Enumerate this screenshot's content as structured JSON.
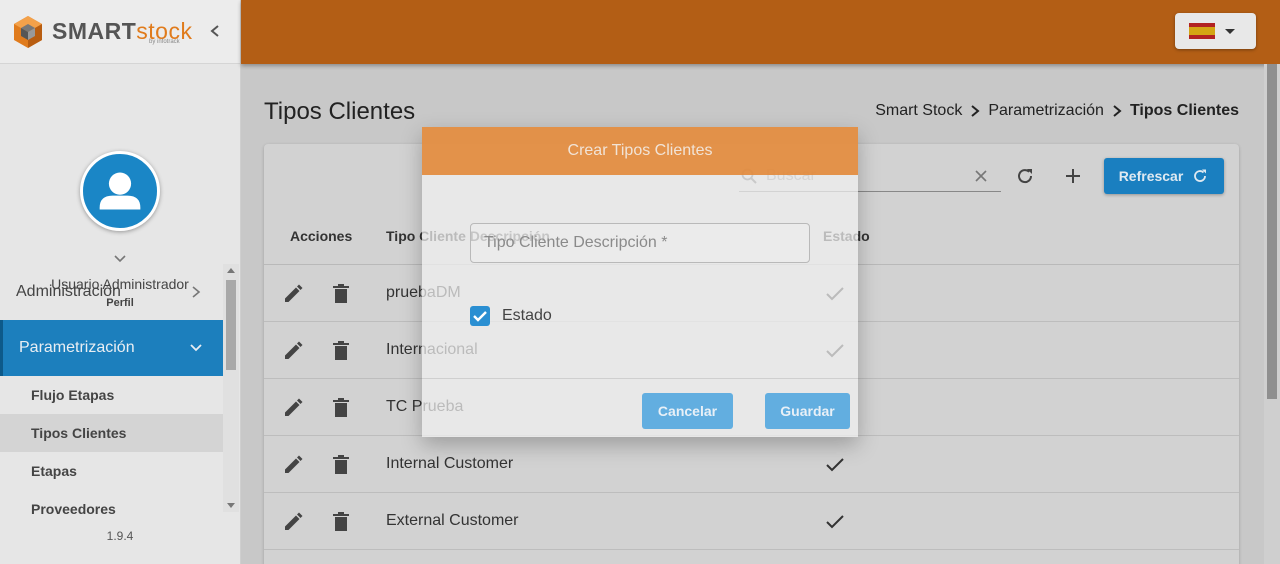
{
  "brand": {
    "name_part1": "SMART",
    "name_part2": "stock",
    "sub": "by infotrack"
  },
  "language": {
    "selected": "es",
    "icon": "spain-flag-icon"
  },
  "profile": {
    "user_name": "Usuario Administrador",
    "role": "Perfil"
  },
  "menu": {
    "items": [
      {
        "label": "Administración",
        "expanded": false
      },
      {
        "label": "Parametrización",
        "expanded": true
      }
    ],
    "sub_items": [
      "Flujo Etapas",
      "Tipos Clientes",
      "Etapas",
      "Proveedores"
    ],
    "selected_sub": "Tipos Clientes"
  },
  "version": "1.9.4",
  "page": {
    "title": "Tipos Clientes"
  },
  "breadcrumb": [
    "Smart Stock",
    "Parametrización",
    "Tipos Clientes"
  ],
  "toolbar": {
    "search_placeholder": "Buscar",
    "refresh_label": "Refrescar"
  },
  "table": {
    "columns": [
      "Acciones",
      "Tipo Cliente Descripción",
      "Estado"
    ],
    "rows": [
      {
        "description": "pruebaDM",
        "active": true
      },
      {
        "description": "Internacional",
        "active": true
      },
      {
        "description": "TC Prueba",
        "active": false
      },
      {
        "description": "Internal Customer",
        "active": true
      },
      {
        "description": "External Customer",
        "active": true
      }
    ]
  },
  "modal": {
    "title": "Crear Tipos Clientes",
    "field_placeholder": "Tipo Cliente Descripción *",
    "checkbox_label": "Estado",
    "checkbox_checked": true,
    "cancel_label": "Cancelar",
    "save_label": "Guardar"
  },
  "colors": {
    "topbar": "#b35e15",
    "modal_header": "#e28a3c",
    "primary": "#1a7fc0",
    "button_light": "#62aee0"
  }
}
